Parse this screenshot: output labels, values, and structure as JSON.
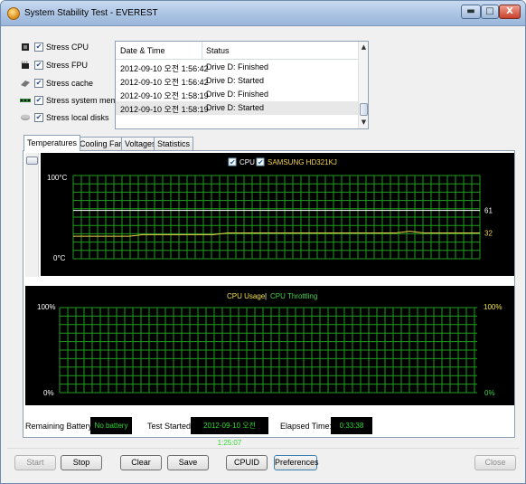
{
  "window": {
    "title": "System Stability Test - EVEREST",
    "controls": {
      "minimize": "▬",
      "maximize": "□",
      "close": "X"
    }
  },
  "stress_options": [
    {
      "label": "Stress CPU",
      "checked": true,
      "icon": "cpu-icon"
    },
    {
      "label": "Stress FPU",
      "checked": true,
      "icon": "fpu-icon"
    },
    {
      "label": "Stress cache",
      "checked": true,
      "icon": "cache-icon"
    },
    {
      "label": "Stress system memory",
      "checked": true,
      "icon": "memory-icon"
    },
    {
      "label": "Stress local disks",
      "checked": true,
      "icon": "disk-icon"
    }
  ],
  "log": {
    "columns": {
      "datetime": "Date & Time",
      "status": "Status"
    },
    "rows": [
      {
        "datetime": "2012-09-10 오전 1:56:42",
        "status": "Drive D: Finished"
      },
      {
        "datetime": "2012-09-10 오전 1:56:42",
        "status": "Drive D: Started"
      },
      {
        "datetime": "2012-09-10 오전 1:58:19",
        "status": "Drive D: Finished"
      },
      {
        "datetime": "2012-09-10 오전 1:58:19",
        "status": "Drive D: Started"
      }
    ],
    "selected_row": 3
  },
  "tabs": [
    "Temperatures",
    "Cooling Fans",
    "Voltages",
    "Statistics"
  ],
  "active_tab": "Temperatures",
  "chart_data": [
    {
      "type": "line",
      "title": "",
      "ylabel_top": "100°C",
      "ylabel_bottom": "0°C",
      "ylim": [
        0,
        100
      ],
      "grid": true,
      "legend_placement": "top-center",
      "series": [
        {
          "name": "CPU",
          "checked": true,
          "color": "#ffffff",
          "current_label": "61",
          "values": [
            58,
            58,
            58,
            58,
            58,
            58,
            58,
            58,
            58,
            58,
            58,
            58,
            58,
            58,
            58,
            58,
            58,
            58,
            58,
            58,
            58,
            58,
            58,
            58,
            58,
            58,
            58,
            58,
            58,
            58
          ]
        },
        {
          "name": "SAMSUNG HD321KJ",
          "checked": true,
          "color": "#f2d24b",
          "current_label": "32",
          "values": [
            27,
            27,
            27,
            27,
            27,
            29,
            29,
            29,
            29,
            29,
            29,
            31,
            31,
            31,
            31,
            31,
            31,
            31,
            31,
            31,
            31,
            31,
            31,
            31,
            33,
            31,
            31,
            31,
            31,
            31
          ]
        }
      ]
    },
    {
      "type": "line",
      "title": "",
      "legend": {
        "left": "CPU Usage",
        "separator": "|",
        "right": "CPU Throttling"
      },
      "left_axis": {
        "top": "100%",
        "bottom": "0%"
      },
      "right_axis": {
        "top": "100%",
        "bottom": "0%"
      },
      "ylim": [
        0,
        100
      ],
      "grid": true,
      "series": [
        {
          "name": "CPU Usage",
          "color": "#f2e14b",
          "values": []
        },
        {
          "name": "CPU Throttling",
          "color": "#3fd24a",
          "values": []
        }
      ]
    }
  ],
  "status": {
    "battery_label": "Remaining Battery:",
    "battery_value": "No battery",
    "started_label": "Test Started:",
    "started_value": "2012-09-10 오전 1:25:07",
    "elapsed_label": "Elapsed Time:",
    "elapsed_value": "0:33:38"
  },
  "buttons": {
    "start": "Start",
    "stop": "Stop",
    "clear": "Clear",
    "save": "Save",
    "cpuid": "CPUID",
    "preferences": "Preferences",
    "close": "Close"
  },
  "colors": {
    "grid": "#1f9e1f",
    "chart_bg": "#000000",
    "status_text": "#2fd82f"
  }
}
